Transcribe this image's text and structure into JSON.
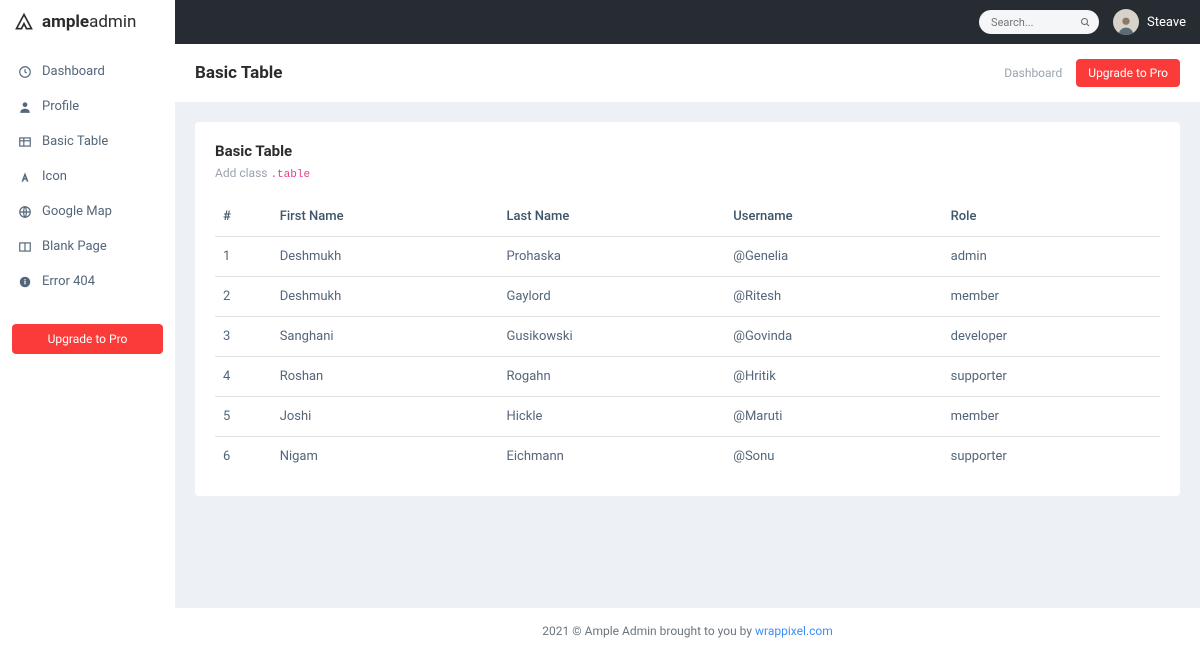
{
  "brand": {
    "bold": "ample",
    "light": "admin"
  },
  "sidebar": {
    "items": [
      {
        "label": "Dashboard"
      },
      {
        "label": "Profile"
      },
      {
        "label": "Basic Table"
      },
      {
        "label": "Icon"
      },
      {
        "label": "Google Map"
      },
      {
        "label": "Blank Page"
      },
      {
        "label": "Error 404"
      }
    ],
    "upgrade_label": "Upgrade to Pro"
  },
  "topbar": {
    "search_placeholder": "Search...",
    "profile_name": "Steave"
  },
  "page": {
    "title": "Basic Table",
    "breadcrumb": "Dashboard",
    "upgrade_label": "Upgrade to Pro"
  },
  "card": {
    "title": "Basic Table",
    "subtitle_prefix": "Add class ",
    "subtitle_code": ".table"
  },
  "table": {
    "headers": [
      "#",
      "First Name",
      "Last Name",
      "Username",
      "Role"
    ],
    "rows": [
      [
        "1",
        "Deshmukh",
        "Prohaska",
        "@Genelia",
        "admin"
      ],
      [
        "2",
        "Deshmukh",
        "Gaylord",
        "@Ritesh",
        "member"
      ],
      [
        "3",
        "Sanghani",
        "Gusikowski",
        "@Govinda",
        "developer"
      ],
      [
        "4",
        "Roshan",
        "Rogahn",
        "@Hritik",
        "supporter"
      ],
      [
        "5",
        "Joshi",
        "Hickle",
        "@Maruti",
        "member"
      ],
      [
        "6",
        "Nigam",
        "Eichmann",
        "@Sonu",
        "supporter"
      ]
    ]
  },
  "footer": {
    "text": "2021 © Ample Admin brought to you by ",
    "link_text": "wrappixel.com"
  }
}
